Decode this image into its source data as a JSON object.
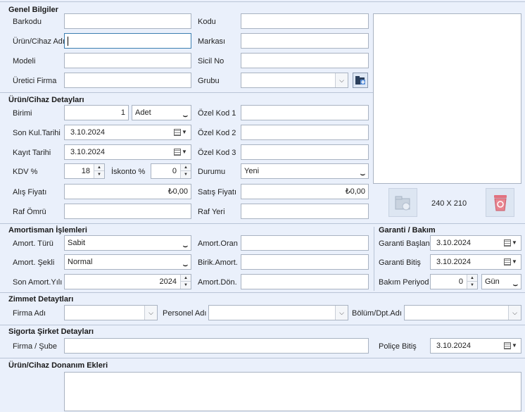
{
  "genel": {
    "title": "Genel Bilgiler",
    "barkodu": "Barkodu",
    "kodu": "Kodu",
    "urun_adi": "Ürün/Cihaz Adı",
    "markasi": "Markası",
    "modeli": "Modeli",
    "sicil_no": "Sicil No",
    "uretici": "Üretici Firma",
    "grubu": "Grubu",
    "values": {
      "barkodu": "",
      "kodu": "",
      "urun_adi": "",
      "markasi": "",
      "modeli": "",
      "sicil_no": "",
      "uretici": "",
      "grubu": ""
    }
  },
  "image": {
    "size_label": "240 X 210"
  },
  "detay": {
    "title": "Ürün/Cihaz Detayları",
    "birimi": "Birimi",
    "birim_qty": "1",
    "birim_unit": "Adet",
    "son_kul": "Son Kul.Tarihi",
    "son_kul_val": "3.10.2024",
    "kayit": "Kayıt Tarihi",
    "kayit_val": "3.10.2024",
    "kdv": "KDV %",
    "kdv_val": "18",
    "iskonto": "İskonto %",
    "iskonto_val": "0",
    "alis": "Alış Fiyatı",
    "alis_val": "₺0,00",
    "raf_omru": "Raf Ömrü",
    "ozel1": "Özel Kod 1",
    "ozel2": "Özel Kod 2",
    "ozel3": "Özel Kod 3",
    "durumu": "Durumu",
    "durumu_val": "Yeni",
    "satis": "Satış Fiyatı",
    "satis_val": "₺0,00",
    "raf_yeri": "Raf Yeri"
  },
  "amortisman": {
    "title": "Amortisman İşlemleri",
    "turu": "Amort. Türü",
    "turu_val": "Sabit",
    "sekli": "Amort. Şekli",
    "sekli_val": "Normal",
    "son_yil": "Son Amort.Yılı",
    "son_yil_val": "2024",
    "oran": "Amort.Oran",
    "birik": "Birik.Amort.",
    "don": "Amort.Dön."
  },
  "garanti": {
    "title": "Garanti / Bakım",
    "baslan": "Garanti Başlan.",
    "baslan_val": "3.10.2024",
    "bitis": "Garanti Bitiş",
    "bitis_val": "3.10.2024",
    "periyod": "Bakım Periyod",
    "periyod_val": "0",
    "periyod_unit": "Gün"
  },
  "zimmet": {
    "title": "Zimmet Detaytları",
    "firma": "Firma Adı",
    "personel": "Personel Adı",
    "bolum": "Bölüm/Dpt.Adı"
  },
  "sigorta": {
    "title": "Sigorta Şirket Detayları",
    "firma": "Firma / Şube",
    "police": "Poliçe Bitiş",
    "police_val": "3.10.2024"
  },
  "donanim": {
    "title": "Ürün/Cihaz Donanım Ekleri"
  }
}
